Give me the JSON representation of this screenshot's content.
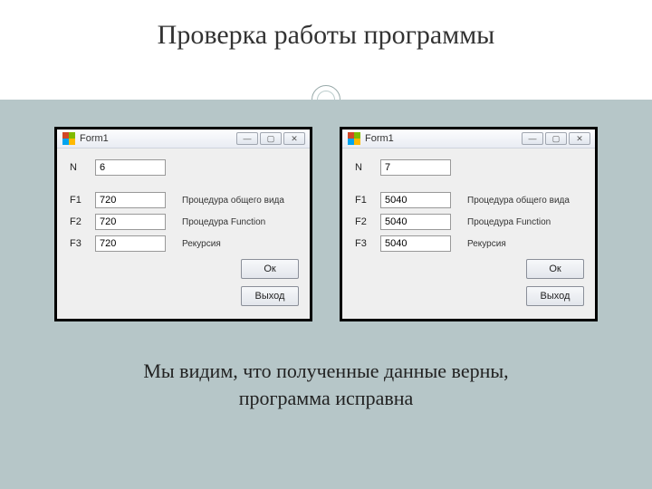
{
  "slide": {
    "title": "Проверка работы программы",
    "caption_line1": "Мы видим, что полученные данные верны,",
    "caption_line2": "программа исправна"
  },
  "form_shared": {
    "window_title": "Form1",
    "labels": {
      "n": "N",
      "f1": "F1",
      "f2": "F2",
      "f3": "F3"
    },
    "descriptions": {
      "f1": "Процедура общего вида",
      "f2": "Процедура Function",
      "f3": "Рекурсия"
    },
    "buttons": {
      "ok": "Ок",
      "exit": "Выход"
    },
    "min_glyph": "—",
    "max_glyph": "▢",
    "close_glyph": "✕"
  },
  "forms": [
    {
      "n": "6",
      "f1": "720",
      "f2": "720",
      "f3": "720"
    },
    {
      "n": "7",
      "f1": "5040",
      "f2": "5040",
      "f3": "5040"
    }
  ]
}
